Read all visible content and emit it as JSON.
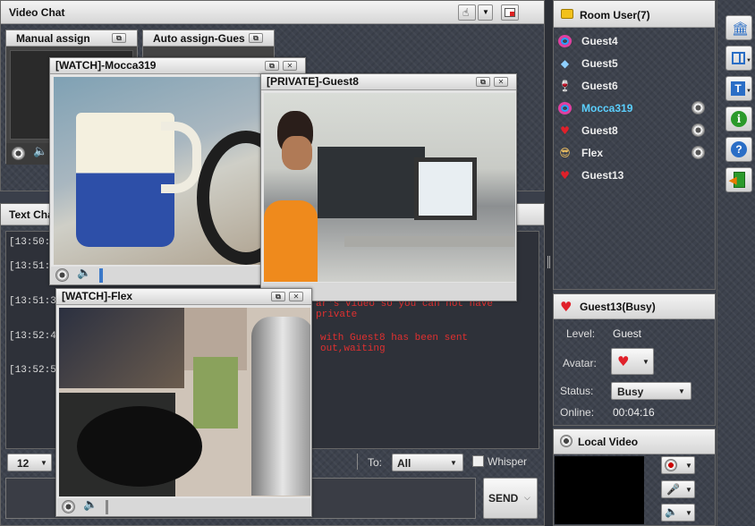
{
  "video_chat": {
    "title": "Video Chat"
  },
  "manual_panel": {
    "title": "Manual assign"
  },
  "auto_panel": {
    "title": "Auto assign-Gues"
  },
  "text_chat": {
    "title": "Text Chat"
  },
  "windows": [
    {
      "title": "[WATCH]-Mocca319"
    },
    {
      "title": "[PRIVATE]-Guest8"
    },
    {
      "title": "[WATCH]-Flex"
    }
  ],
  "chat_log": [
    {
      "time": "[13:50:4"
    },
    {
      "time": "[13:51:3"
    },
    {
      "time": "[13:51:35]"
    },
    {
      "time": "[13:52:40]"
    },
    {
      "time": "[13:52:59]"
    }
  ],
  "system_messages": [
    "ar's video so you can not have private",
    "with Guest8 has been sent out,waiting"
  ],
  "font_size": "12",
  "to_label": "To:",
  "to_value": "All",
  "whisper_label": "Whisper",
  "send_label": "SEND",
  "room_users": {
    "title": "Room User(7)",
    "users": [
      {
        "name": "Guest4",
        "icon": "rainbow-ring-icon",
        "cam": false,
        "highlight": false
      },
      {
        "name": "Guest5",
        "icon": "diamond-icon",
        "cam": false,
        "highlight": false
      },
      {
        "name": "Guest6",
        "icon": "wine-glass-icon",
        "cam": false,
        "highlight": false
      },
      {
        "name": "Mocca319",
        "icon": "rainbow-ring-icon",
        "cam": true,
        "highlight": true
      },
      {
        "name": "Guest8",
        "icon": "heart-icon",
        "cam": true,
        "highlight": false
      },
      {
        "name": "Flex",
        "icon": "sunglasses-face-icon",
        "cam": true,
        "highlight": false
      },
      {
        "name": "Guest13",
        "icon": "broken-heart-icon",
        "cam": false,
        "highlight": false
      }
    ]
  },
  "user_info": {
    "title": "Guest13(Busy)",
    "level_label": "Level:",
    "level_value": "Guest",
    "avatar_label": "Avatar:",
    "status_label": "Status:",
    "status_value": "Busy",
    "online_label": "Online:",
    "online_value": "00:04:16"
  },
  "local_video": {
    "title": "Local Video"
  },
  "colors": {
    "accent_highlight": "#5bd0ff",
    "system_text": "#e03030",
    "panel_bg": "#3d424d"
  }
}
